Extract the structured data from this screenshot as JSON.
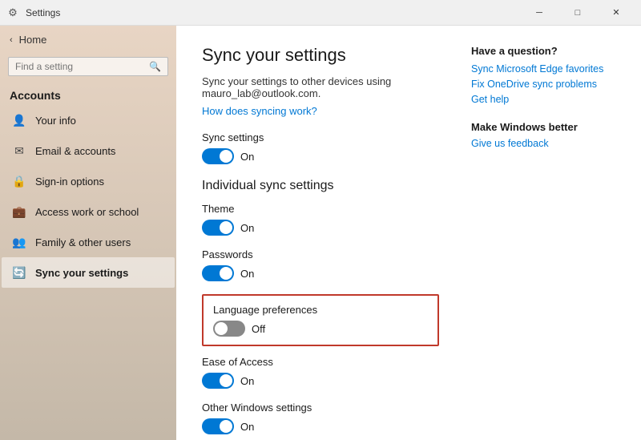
{
  "titlebar": {
    "icon": "⚙",
    "title": "Settings",
    "minimize_label": "─",
    "maximize_label": "□",
    "close_label": "✕"
  },
  "sidebar": {
    "back_label": "Home",
    "search_placeholder": "Find a setting",
    "section_title": "Accounts",
    "items": [
      {
        "id": "your-info",
        "label": "Your info",
        "icon": "👤"
      },
      {
        "id": "email-accounts",
        "label": "Email & accounts",
        "icon": "✉"
      },
      {
        "id": "sign-in",
        "label": "Sign-in options",
        "icon": "🔒"
      },
      {
        "id": "work-school",
        "label": "Access work or school",
        "icon": "💼"
      },
      {
        "id": "family-users",
        "label": "Family & other users",
        "icon": "👥"
      },
      {
        "id": "sync-settings",
        "label": "Sync your settings",
        "icon": "🔄"
      }
    ]
  },
  "content": {
    "page_title": "Sync your settings",
    "description": "Sync your settings to other devices using mauro_lab@outlook.com.",
    "how_does_syncing_work": "How does syncing work?",
    "sync_settings_label": "Sync settings",
    "sync_settings_state": "On",
    "sync_settings_on": true,
    "individual_sync_title": "Individual sync settings",
    "settings_items": [
      {
        "id": "theme",
        "label": "Theme",
        "state": "On",
        "on": true
      },
      {
        "id": "passwords",
        "label": "Passwords",
        "state": "On",
        "on": true
      },
      {
        "id": "language-preferences",
        "label": "Language preferences",
        "state": "Off",
        "on": false,
        "highlight": true
      },
      {
        "id": "ease-of-access",
        "label": "Ease of Access",
        "state": "On",
        "on": true
      },
      {
        "id": "other-windows",
        "label": "Other Windows settings",
        "state": "On",
        "on": true
      }
    ]
  },
  "right_panel": {
    "have_question_title": "Have a question?",
    "links": [
      {
        "id": "edge-favorites",
        "label": "Sync Microsoft Edge favorites"
      },
      {
        "id": "onedrive-sync",
        "label": "Fix OneDrive sync problems"
      },
      {
        "id": "get-help",
        "label": "Get help"
      }
    ],
    "make_better_title": "Make Windows better",
    "feedback_link": "Give us feedback"
  }
}
